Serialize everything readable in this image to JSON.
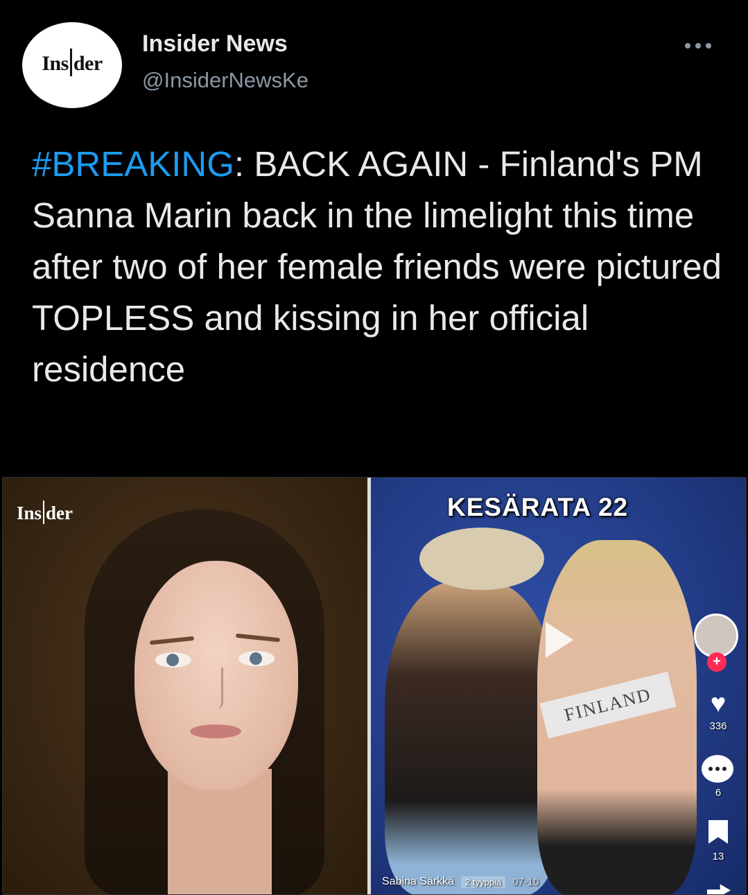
{
  "account": {
    "display_name": "Insider News",
    "handle": "@InsiderNewsKe",
    "avatar_logo": "Insider",
    "more_icon": "more-horizontal-icon"
  },
  "tweet": {
    "hashtag": "#BREAKING",
    "text_after_hashtag": ": BACK AGAIN - Finland's PM Sanna Marin back in the limelight this time after two of her female friends were pictured TOPLESS and kissing in her official residence"
  },
  "media": {
    "left_logo": "Insider",
    "right_title": "KESÄRATA 22",
    "sign_text": "FINLAND",
    "like_count": "336",
    "comment_count": "6",
    "bookmark_count": "13",
    "creator_name": "Sabina Särkkä",
    "chip_text": "2 tyyppiä",
    "date": "07-10"
  },
  "colors": {
    "background": "#000000",
    "hashtag": "#1d9bf0",
    "handle": "#8b98a5"
  }
}
